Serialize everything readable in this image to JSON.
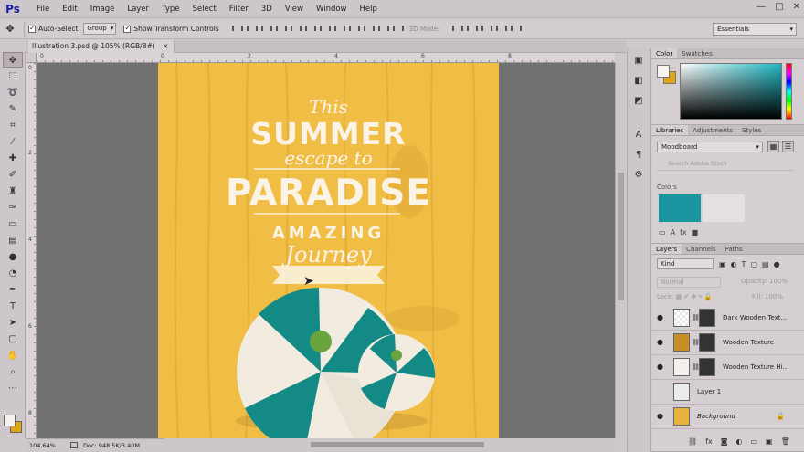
{
  "app": {
    "logo": "Ps",
    "menus": [
      "File",
      "Edit",
      "Image",
      "Layer",
      "Type",
      "Select",
      "Filter",
      "3D",
      "View",
      "Window",
      "Help"
    ],
    "window_controls": [
      "—",
      "□",
      "✕"
    ]
  },
  "options": {
    "auto_select_label": "Auto-Select",
    "auto_select_value": "Group",
    "show_transform_label": "Show Transform Controls",
    "mode_3d_label": "3D Mode:",
    "workspace": "Essentials"
  },
  "document": {
    "tab_title": "Illustration 3.psd @ 105% (RGB/8#)",
    "close_glyph": "×",
    "ruler_ticks": [
      "0",
      "2",
      "4",
      "6",
      "8"
    ],
    "zoom": "104.64%",
    "doc_size": "Doc: 948.5K/3.40M"
  },
  "artwork": {
    "line_this": "This",
    "line_summer": "SUMMER",
    "line_escape": "escape to",
    "line_paradise": "PARADISE",
    "line_amazing": "AMAZING",
    "line_journey": "Journey",
    "bg_color": "#f0bd45",
    "ball_teal": "#148a86",
    "ball_green": "#6aa43f"
  },
  "panels": {
    "color_tabs": [
      "Color",
      "Swatches"
    ],
    "library_tabs": [
      "Libraries",
      "Adjustments",
      "Styles"
    ],
    "library_select": "Moodboard",
    "library_search_placeholder": "Search Adobe Stock",
    "library_section": "Colors",
    "library_colors": [
      "#1a96a0",
      "#e4e0e2"
    ],
    "layers_tabs": [
      "Layers",
      "Channels",
      "Paths"
    ],
    "kind_label": "Kind",
    "blend_mode": "Normal",
    "opacity_label": "Opacity:",
    "opacity_value": "100%",
    "lock_label": "Lock:",
    "fill_label": "Fill:",
    "fill_value": "100%",
    "layers": [
      {
        "name": "Dark Wooden Text..."
      },
      {
        "name": "Wooden Texture"
      },
      {
        "name": "Wooden Texture Hi..."
      },
      {
        "name": "Layer 1"
      },
      {
        "name": "Background"
      }
    ]
  }
}
